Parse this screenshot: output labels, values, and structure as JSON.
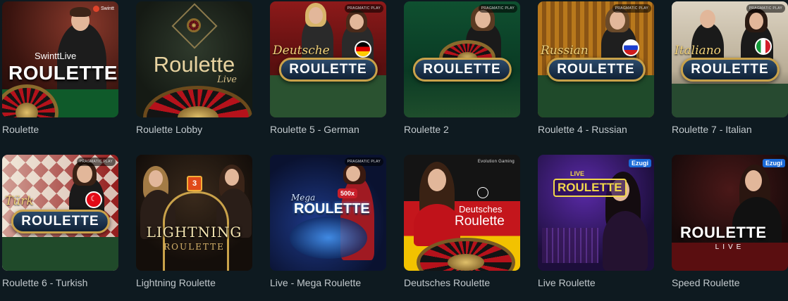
{
  "games": [
    {
      "caption": "Roulette",
      "logo": "ROULETTE",
      "brand": "SwinttLive",
      "provider": "Swintt"
    },
    {
      "caption": "Roulette Lobby",
      "logo": "Roulette",
      "sub": "Live"
    },
    {
      "caption": "Roulette 5 - German",
      "logo": "ROULETTE",
      "script": "Deutsche",
      "provider": "PRAGMATIC PLAY"
    },
    {
      "caption": "Roulette 2",
      "logo": "ROULETTE",
      "provider": "PRAGMATIC PLAY"
    },
    {
      "caption": "Roulette 4 - Russian",
      "logo": "ROULETTE",
      "script": "Russian",
      "provider": "PRAGMATIC PLAY"
    },
    {
      "caption": "Roulette 7 - Italian",
      "logo": "ROULETTE",
      "script": "Italiano",
      "provider": "PRAGMATIC PLAY"
    },
    {
      "caption": "Roulette 6 - Turkish",
      "logo": "ROULETTE",
      "script": "Türk",
      "provider": "PRAGMATIC PLAY"
    },
    {
      "caption": "Lightning Roulette",
      "logo": "LIGHTNING",
      "sub": "ROULETTE",
      "multiplier": "3"
    },
    {
      "caption": "Live - Mega Roulette",
      "logo": "ROULETTE",
      "script": "Mega",
      "multiplier": "500x",
      "provider": "PRAGMATIC PLAY"
    },
    {
      "caption": "Deutsches Roulette",
      "logo": "Roulette",
      "script": "Deutsches",
      "provider": "Evolution Gaming"
    },
    {
      "caption": "Live Roulette",
      "logo": "ROULETTE",
      "sub": "LIVE",
      "provider": "Ezugi"
    },
    {
      "caption": "Speed Roulette",
      "logo": "ROULETTE",
      "sub": "LIVE",
      "provider": "Ezugi"
    }
  ]
}
